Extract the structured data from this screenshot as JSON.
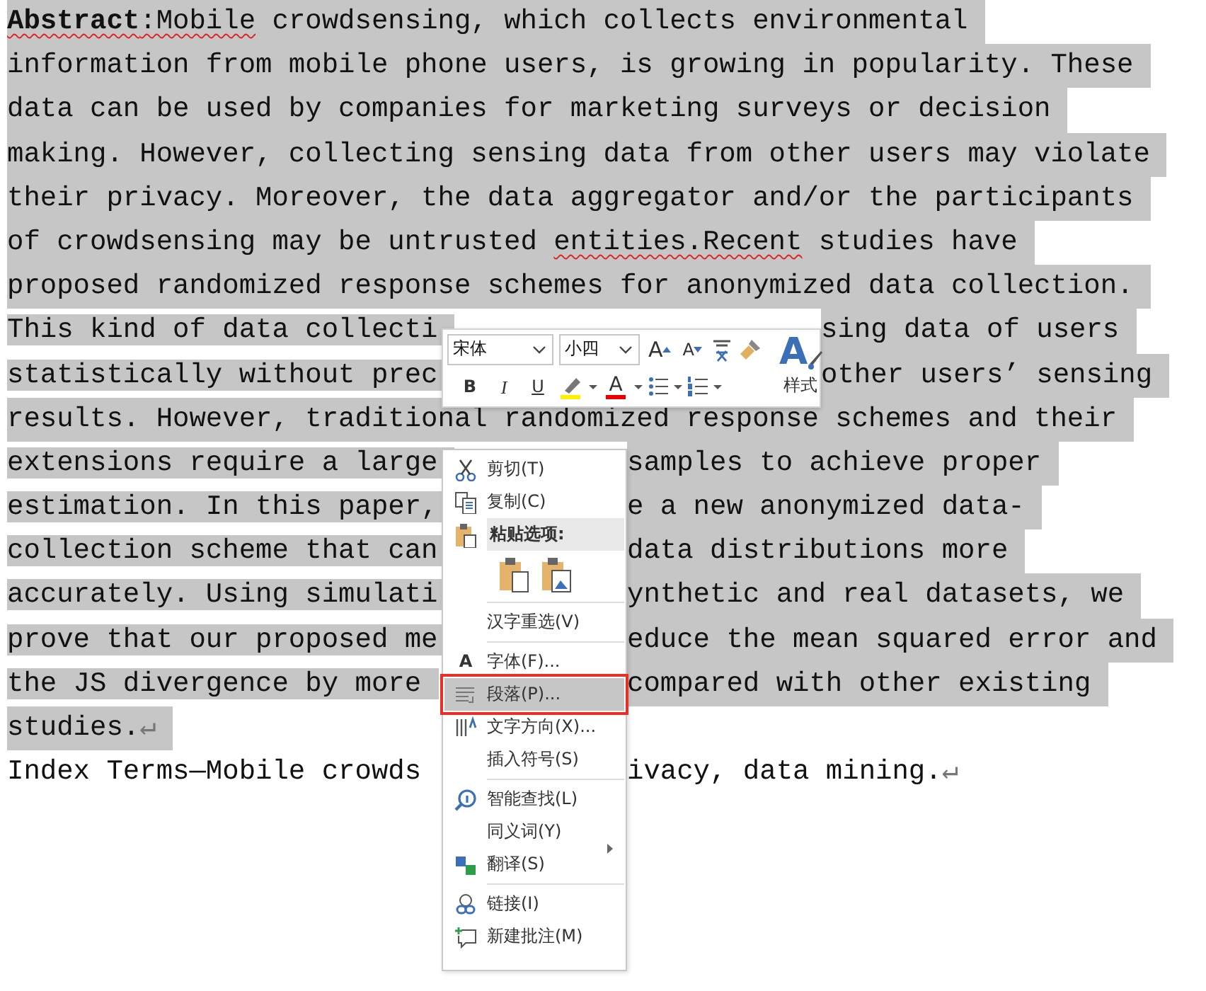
{
  "document": {
    "lines": [
      {
        "runs": [
          {
            "text": "Abstract",
            "bold": true,
            "misspelled": true
          },
          {
            "text": ":Mobile",
            "misspelled": true
          },
          {
            "text": " crowdsensing, which collects environmental"
          }
        ],
        "selected": true
      },
      {
        "text": "information from mobile phone users, is growing in popularity. These",
        "selected": true
      },
      {
        "text": "data can be used by companies for marketing surveys or decision",
        "selected": true
      },
      {
        "text": "making. However, collecting sensing data from other users may violate",
        "selected": true
      },
      {
        "text": "their privacy. Moreover, the data aggregator and/or the participants",
        "selected": true
      },
      {
        "runs": [
          {
            "text": "of crowdsensing may be untrusted "
          },
          {
            "text": "entities.Recent",
            "misspelled": true
          },
          {
            "text": " studies have"
          }
        ],
        "selected": true
      },
      {
        "text": "proposed randomized response schemes for anonymized data collection.",
        "selected": true
      },
      {
        "text": "This kind of data collecti",
        "right": "sing data of users",
        "selected": true
      },
      {
        "text": "statistically without prec",
        "right": "other users’ sensing",
        "selected": true
      },
      {
        "text": "results. However, traditional randomized response schemes and their",
        "selected": true
      },
      {
        "text": "extensions require a large",
        "right": "samples to achieve proper",
        "selected": true
      },
      {
        "text": "estimation. In this paper,",
        "right": "e a new anonymized data-",
        "selected": true
      },
      {
        "text": "collection scheme that can",
        "right": "data distributions more",
        "selected": true
      },
      {
        "text": "accurately. Using simulati",
        "right": "ynthetic and real datasets, we",
        "selected": true
      },
      {
        "text": "prove that our proposed me",
        "right": "educe the mean squared error and",
        "selected": true
      },
      {
        "text": "the JS divergence by more",
        "right": "compared with other existing",
        "selected": true
      },
      {
        "text": "studies.",
        "mark": "↵",
        "selected": true
      },
      {
        "text": "Index Terms—Mobile crowds",
        "right": "ivacy, data mining.",
        "mark": "↵",
        "selected": false
      }
    ]
  },
  "mini_toolbar": {
    "font": "宋体",
    "size": "小四",
    "grow": "A",
    "shrink": "A",
    "bold": "B",
    "italic": "I",
    "underline": "U",
    "font_color": "A",
    "styles_glyph": "A",
    "styles_label": "样式"
  },
  "context_menu": [
    {
      "kind": "item",
      "label": "剪切(T)",
      "selected": false
    },
    {
      "kind": "item",
      "label": "复制(C)",
      "selected": false
    },
    {
      "kind": "header",
      "label": "粘贴选项:"
    },
    {
      "kind": "paste_options"
    },
    {
      "kind": "separator"
    },
    {
      "kind": "item",
      "label": "汉字重选(V)",
      "selected": false
    },
    {
      "kind": "separator"
    },
    {
      "kind": "item",
      "label": "字体(F)...",
      "glyph": "A",
      "selected": false
    },
    {
      "kind": "item",
      "label": "段落(P)...",
      "selected": true,
      "outlined": true
    },
    {
      "kind": "item",
      "label": "文字方向(X)...",
      "selected": false
    },
    {
      "kind": "item",
      "label": "插入符号(S)",
      "selected": false
    },
    {
      "kind": "separator"
    },
    {
      "kind": "item",
      "label": "智能查找(L)",
      "selected": false
    },
    {
      "kind": "item",
      "label": "同义词(Y)",
      "submenu": true,
      "selected": false
    },
    {
      "kind": "item",
      "label": "翻译(S)",
      "selected": false
    },
    {
      "kind": "separator"
    },
    {
      "kind": "item",
      "label": "链接(I)",
      "selected": false
    },
    {
      "kind": "item",
      "label": "新建批注(M)",
      "selected": false
    }
  ]
}
